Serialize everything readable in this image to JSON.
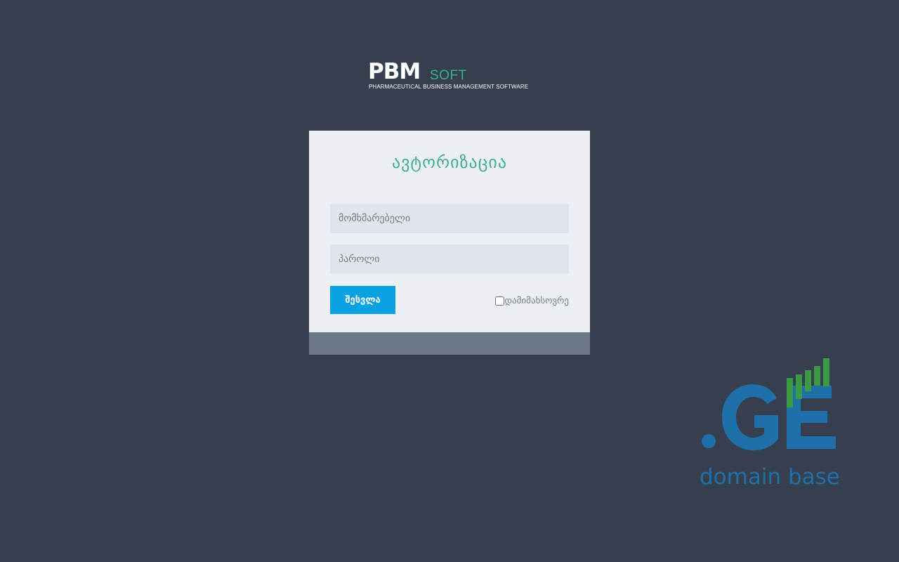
{
  "logo": {
    "main": "PBM",
    "sub": "SOFT",
    "tagline": "PHARMACEUTICAL BUSINESS MANAGEMENT SOFTWARE"
  },
  "login": {
    "title": "ავტორიზაცია",
    "username_placeholder": "მომხმარებელი",
    "password_placeholder": "პაროლი",
    "submit_label": "შესვლა",
    "remember_label": "დამიმახსოვრე",
    "remember_checked": false
  },
  "watermark": {
    "mark": ".GE",
    "text": "domain base"
  },
  "colors": {
    "background": "#353f4e",
    "card": "#eceff3",
    "accent_green": "#3fb28c",
    "button_blue": "#0aa2e2",
    "watermark_blue": "#1f6fa8",
    "watermark_green": "#3c9a45"
  }
}
